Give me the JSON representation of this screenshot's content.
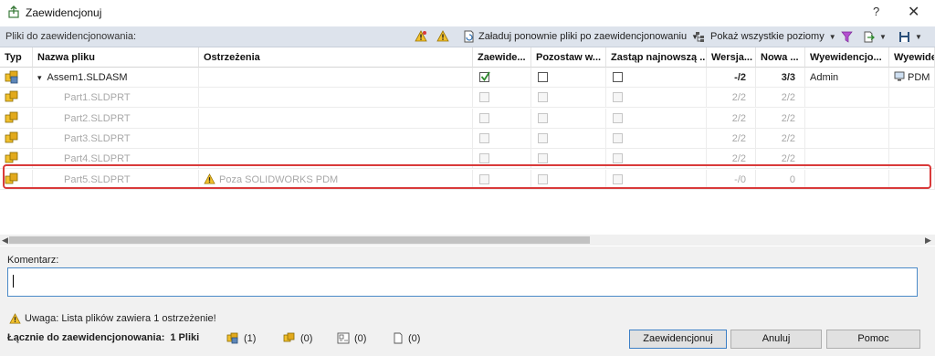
{
  "window": {
    "title": "Zaewidencjonuj",
    "help": "?",
    "close": "✕"
  },
  "toolbar": {
    "label": "Pliki do zaewidencjonowania:",
    "reload_label": "Załaduj ponownie pliki po zaewidencjonowaniu",
    "show_levels_label": "Pokaż wszystkie poziomy"
  },
  "columns": [
    "Typ",
    "Nazwa pliku",
    "Ostrzeżenia",
    "Zaewide...",
    "Pozostaw w...",
    "Zastąp najnowszą ...",
    "Wersja...",
    "Nowa ...",
    "Wyewidencjo...",
    "Wyewidency"
  ],
  "rows": [
    {
      "name": "Assem1.SLDASM",
      "expander": "▾",
      "warning": "",
      "checked": true,
      "enabled": true,
      "version": "-/2",
      "new_version": "3/3",
      "checked_out_by": "Admin",
      "checked_out_in": "PDM",
      "icon": "assembly-icon"
    },
    {
      "name": "Part1.SLDPRT",
      "expander": "",
      "warning": "",
      "checked": false,
      "enabled": false,
      "version": "2/2",
      "new_version": "2/2",
      "checked_out_by": "",
      "checked_out_in": "",
      "icon": "part-icon"
    },
    {
      "name": "Part2.SLDPRT",
      "expander": "",
      "warning": "",
      "checked": false,
      "enabled": false,
      "version": "2/2",
      "new_version": "2/2",
      "checked_out_by": "",
      "checked_out_in": "",
      "icon": "part-icon"
    },
    {
      "name": "Part3.SLDPRT",
      "expander": "",
      "warning": "",
      "checked": false,
      "enabled": false,
      "version": "2/2",
      "new_version": "2/2",
      "checked_out_by": "",
      "checked_out_in": "",
      "icon": "part-icon"
    },
    {
      "name": "Part4.SLDPRT",
      "expander": "",
      "warning": "",
      "checked": false,
      "enabled": false,
      "version": "2/2",
      "new_version": "2/2",
      "checked_out_by": "",
      "checked_out_in": "",
      "icon": "part-icon"
    },
    {
      "name": "Part5.SLDPRT",
      "expander": "",
      "warning": "Poza SOLIDWORKS PDM",
      "checked": false,
      "enabled": false,
      "version": "-/0",
      "new_version": "0",
      "checked_out_by": "",
      "checked_out_in": "",
      "icon": "part-icon"
    }
  ],
  "comment": {
    "label": "Komentarz:",
    "value": ""
  },
  "warning_message": "Uwaga: Lista plików zawiera 1 ostrzeżenie!",
  "totals": {
    "label": "Łącznie do zaewidencjonowania:",
    "count": "1 Pliki",
    "assemblies": "(1)",
    "parts": "(0)",
    "drawings": "(0)",
    "other": "(0)"
  },
  "buttons": {
    "checkin": "Zaewidencjonuj",
    "cancel": "Anuluj",
    "help": "Pomoc"
  },
  "colors": {
    "highlight": "#d93a3a",
    "toolbar_bg": "#dde3ec",
    "accent": "#3c7fc6",
    "warning": "#e8b500"
  }
}
